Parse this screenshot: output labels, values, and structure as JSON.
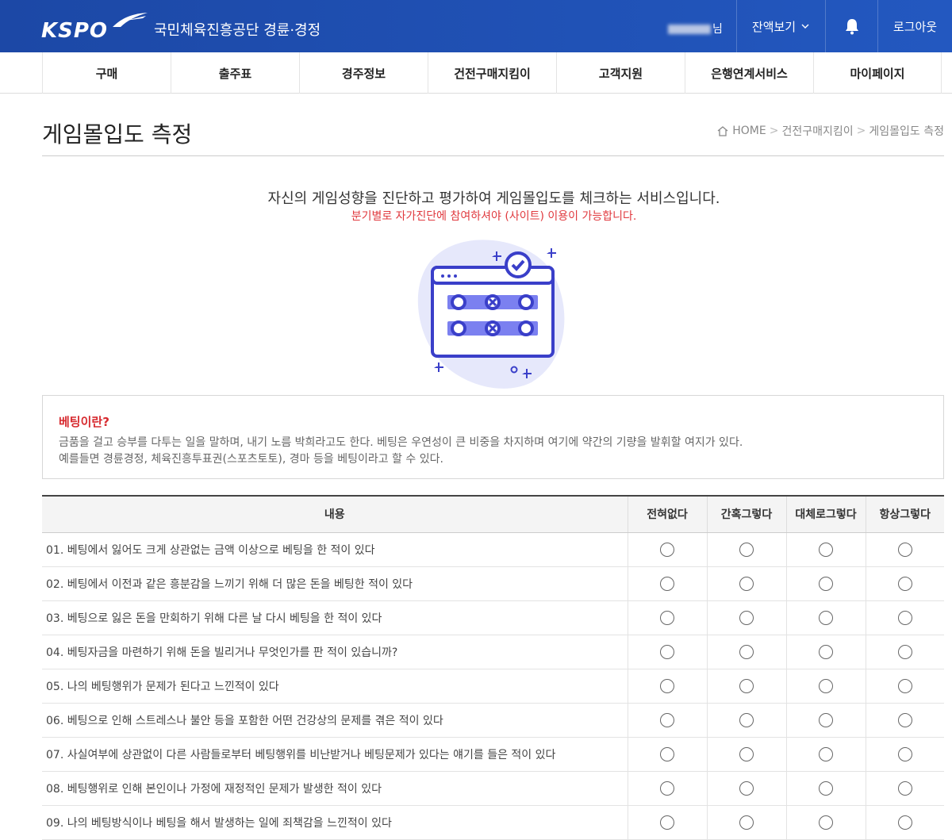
{
  "header": {
    "logo_text": "KSPO",
    "org_name": "국민체육진흥공단 경륜·경정",
    "user_suffix": "님",
    "balance_label": "잔액보기",
    "logout_label": "로그아웃"
  },
  "nav": {
    "items": [
      "구매",
      "출주표",
      "경주정보",
      "건전구매지킴이",
      "고객지원",
      "은행연계서비스",
      "마이페이지"
    ]
  },
  "page": {
    "title": "게임몰입도 측정",
    "breadcrumb": [
      "HOME",
      "건전구매지킴이",
      "게임몰입도 측정"
    ]
  },
  "intro": {
    "main": "자신의 게임성향을 진단하고 평가하여 게임몰입도를 체크하는 서비스입니다.",
    "notice": "분기별로 자가진단에 참여하셔야 (사이트) 이용이 가능합니다."
  },
  "info": {
    "title": "베팅이란?",
    "line1": "금품을 걸고 승부를 다투는 일을 말하며, 내기 노름 박희라고도 한다. 베팅은 우연성이 큰 비중을 차지하며 여기에 약간의 기량을 발휘할 여지가 있다.",
    "line2": "예를들면 경륜경정, 체육진흥투표권(스포츠토토), 경마 등을 베팅이라고 할 수 있다."
  },
  "table": {
    "headers": [
      "내용",
      "전혀없다",
      "간혹그렇다",
      "대체로그렇다",
      "항상그렇다"
    ],
    "questions": [
      "01. 베팅에서 잃어도 크게 상관없는 금액 이상으로 베팅을 한 적이 있다",
      "02. 베팅에서 이전과 같은 흥분감을 느끼기 위해 더 많은 돈을 베팅한 적이 있다",
      "03. 베팅으로 잃은 돈을 만회하기 위해 다른 날 다시 베팅을 한 적이 있다",
      "04. 베팅자금을 마련하기 위해 돈을 빌리거나 무엇인가를 판 적이 있습니까?",
      "05. 나의 베팅행위가 문제가 된다고 느낀적이 있다",
      "06. 베팅으로 인해 스트레스나 불안 등을 포함한 어떤 건강상의 문제를 겪은 적이 있다",
      "07. 사실여부에 상관없이 다른 사람들로부터 베팅행위를 비난받거나 베팅문제가 있다는 얘기를 들은 적이 있다",
      "08. 베팅행위로 인해 본인이나 가정에 재정적인 문제가 발생한 적이 있다",
      "09. 나의 베팅방식이나 베팅을 해서 발생하는 일에 죄책감을 느낀적이 있다"
    ]
  },
  "colors": {
    "header_bg": "#1f4fb0",
    "notice_red": "#e0393e",
    "info_title_red": "#d72a2f",
    "illustration_accent": "#3a3fc9"
  },
  "icons": [
    "bell-icon",
    "chevron-down-icon",
    "home-icon",
    "radio-empty-icon"
  ]
}
